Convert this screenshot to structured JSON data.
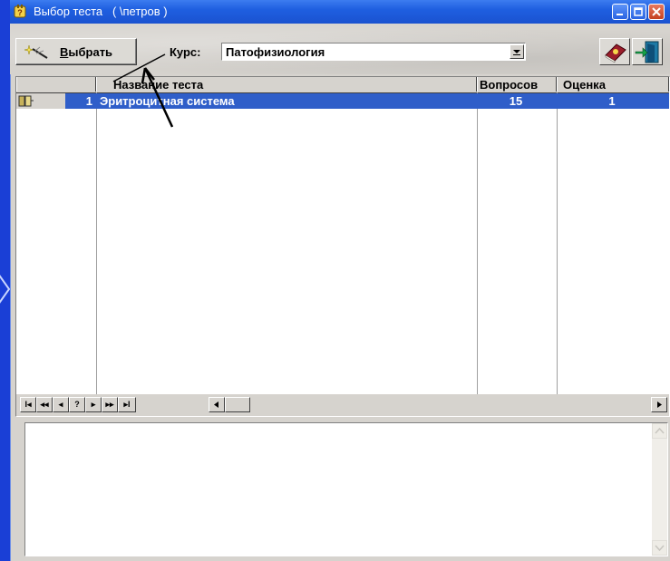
{
  "window": {
    "title": "Выбор теста   ( \\петров )"
  },
  "toolbar": {
    "select_button_prefix": "В",
    "select_button_rest": "ыбрать",
    "course_label": "Курс:",
    "course_value": "Патофизиология"
  },
  "grid": {
    "columns": [
      "Название теста",
      "Вопросов",
      "Оценка"
    ],
    "rows": [
      {
        "num": "1",
        "name": "Эритроцитная система",
        "questions": "15",
        "score": "1",
        "selected": true
      }
    ]
  },
  "navigator": {
    "buttons": [
      "I◂",
      "◂◂",
      "◂",
      "?",
      "▸",
      "▸▸",
      "▸I"
    ]
  },
  "colors": {
    "desktop": "#1a3fd6",
    "titlebar": "#1f5fe0",
    "selection": "#2f5ec9",
    "face": "#d6d3ce"
  },
  "icons": [
    "app-icon",
    "minimize-icon",
    "maximize-icon",
    "close-icon",
    "magic-wand-icon",
    "help-book-icon",
    "exit-door-icon",
    "dropdown-arrow-icon",
    "record-indicator-icon",
    "scroll-up-icon",
    "scroll-down-icon"
  ]
}
